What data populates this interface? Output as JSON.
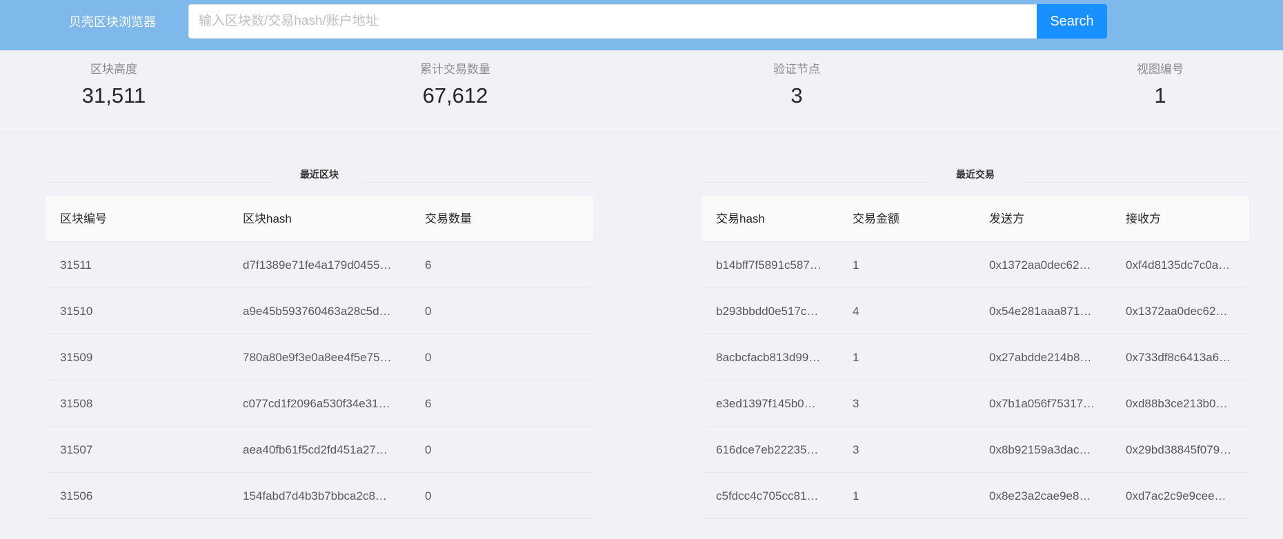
{
  "header": {
    "brand": "贝壳区块浏览器",
    "search_placeholder": "输入区块数/交易hash/账户地址",
    "search_value": "",
    "search_button": "Search"
  },
  "stats": [
    {
      "label": "区块高度",
      "value": "31,511"
    },
    {
      "label": "累计交易数量",
      "value": "67,612"
    },
    {
      "label": "验证节点",
      "value": "3"
    },
    {
      "label": "视图编号",
      "value": "1"
    }
  ],
  "blocks": {
    "title": "最近区块",
    "columns": [
      "区块编号",
      "区块hash",
      "交易数量"
    ],
    "rows": [
      {
        "number": "31511",
        "hash": "d7f1389e71fe4a179d0455…",
        "tx_count": "6"
      },
      {
        "number": "31510",
        "hash": "a9e45b593760463a28c5d…",
        "tx_count": "0"
      },
      {
        "number": "31509",
        "hash": "780a80e9f3e0a8ee4f5e75…",
        "tx_count": "0"
      },
      {
        "number": "31508",
        "hash": "c077cd1f2096a530f34e31…",
        "tx_count": "6"
      },
      {
        "number": "31507",
        "hash": "aea40fb61f5cd2fd451a27…",
        "tx_count": "0"
      },
      {
        "number": "31506",
        "hash": "154fabd7d4b3b7bbca2c8…",
        "tx_count": "0"
      }
    ]
  },
  "transactions": {
    "title": "最近交易",
    "columns": [
      "交易hash",
      "交易金额",
      "发送方",
      "接收方"
    ],
    "rows": [
      {
        "hash": "b14bff7f5891c587…",
        "amount": "1",
        "from": "0x1372aa0dec62…",
        "to": "0xf4d8135dc7c0a…"
      },
      {
        "hash": "b293bbdd0e517c…",
        "amount": "4",
        "from": "0x54e281aaa871…",
        "to": "0x1372aa0dec62…"
      },
      {
        "hash": "8acbcfacb813d99…",
        "amount": "1",
        "from": "0x27abdde214b8…",
        "to": "0x733df8c6413a6…"
      },
      {
        "hash": "e3ed1397f145b0…",
        "amount": "3",
        "from": "0x7b1a056f75317…",
        "to": "0xd88b3ce213b0…"
      },
      {
        "hash": "616dce7eb22235…",
        "amount": "3",
        "from": "0x8b92159a3dac…",
        "to": "0x29bd38845f079…"
      },
      {
        "hash": "c5fdcc4c705cc81…",
        "amount": "1",
        "from": "0x8e23a2cae9e8…",
        "to": "0xd7ac2c9e9cee…"
      }
    ]
  }
}
